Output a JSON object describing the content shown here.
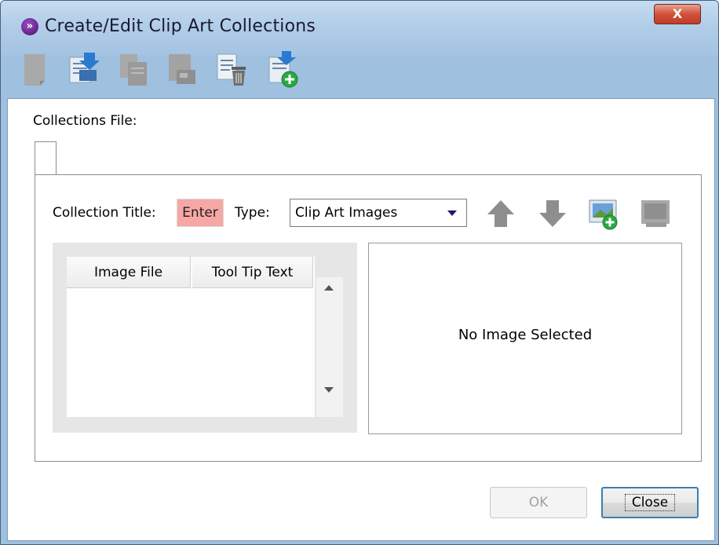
{
  "window": {
    "title": "Create/Edit Clip Art Collections",
    "close_symbol": "X"
  },
  "toolbar": {
    "buttons": [
      {
        "icon": "new-document-icon",
        "enabled": false
      },
      {
        "icon": "open-document-icon",
        "enabled": true
      },
      {
        "icon": "copy-document-icon",
        "enabled": false
      },
      {
        "icon": "save-document-icon",
        "enabled": false
      },
      {
        "icon": "delete-document-icon",
        "enabled": true
      },
      {
        "icon": "add-document-icon",
        "enabled": true
      }
    ]
  },
  "main": {
    "collections_file_label": "Collections File:",
    "collection_title_label": "Collection Title:",
    "collection_title_value": "Enter",
    "type_label": "Type:",
    "type_selected": "Clip Art Images",
    "icons": [
      "move-up-icon",
      "move-down-icon",
      "add-image-icon",
      "remove-image-icon"
    ],
    "table": {
      "columns": [
        "Image File",
        "Tool Tip Text"
      ],
      "rows": []
    },
    "preview_text": "No Image Selected"
  },
  "footer": {
    "ok_label": "OK",
    "close_label": "Close"
  },
  "colors": {
    "title_bar": "#b1cde8",
    "enter_field_bg": "#f7a7a6",
    "close_x_bg": "#d2513b",
    "default_button_border": "#3c7fb1"
  }
}
